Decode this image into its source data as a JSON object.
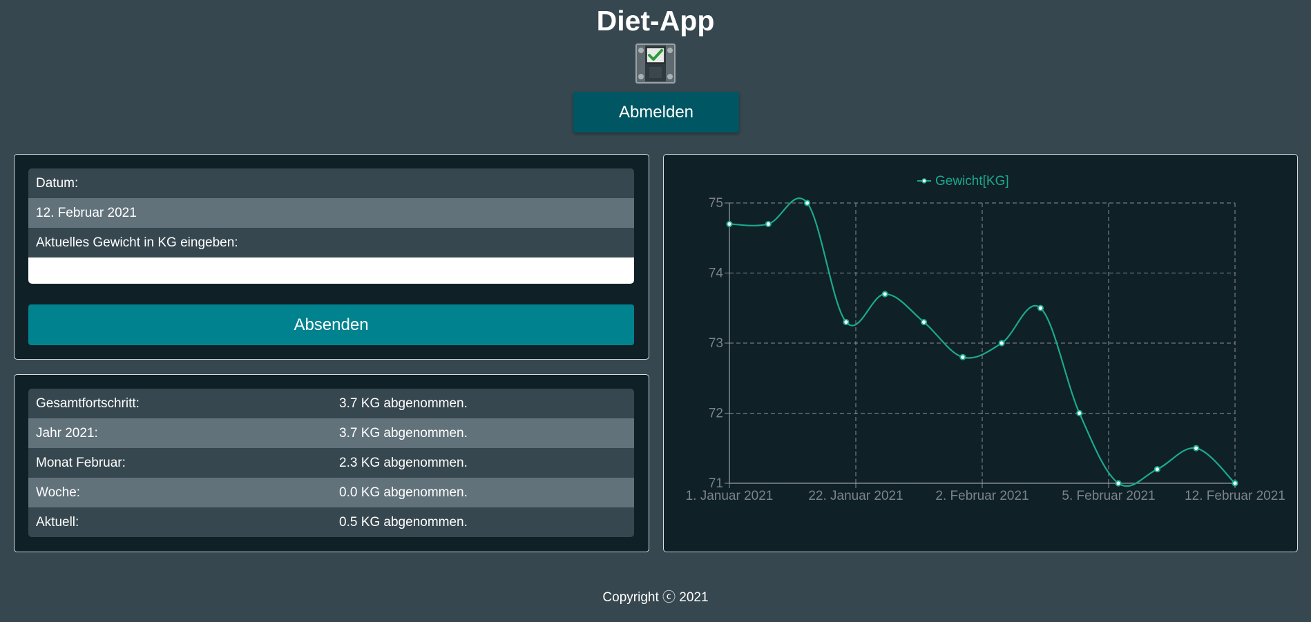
{
  "header": {
    "title": "Diet-App",
    "logout_label": "Abmelden"
  },
  "form": {
    "date_label": "Datum:",
    "date_value": "12. Februar 2021",
    "weight_label": "Aktuelles Gewicht in KG eingeben:",
    "weight_value": "",
    "submit_label": "Absenden"
  },
  "stats": {
    "rows": [
      {
        "label": "Gesamtfortschritt:",
        "value": "3.7 KG abgenommen."
      },
      {
        "label": "Jahr 2021:",
        "value": "3.7 KG abgenommen."
      },
      {
        "label": "Monat Februar:",
        "value": "2.3 KG abgenommen."
      },
      {
        "label": "Woche:",
        "value": "0.0 KG abgenommen."
      },
      {
        "label": "Aktuell:",
        "value": "0.5 KG abgenommen."
      }
    ]
  },
  "footer": {
    "copyright": "Copyright ⓒ 2021"
  },
  "colors": {
    "background": "#37474f",
    "panel": "#102027",
    "accent": "#00838f",
    "logout": "#005662",
    "series": "#1aaa8f"
  },
  "icons": {
    "logo": "scale-check-icon"
  },
  "chart_data": {
    "type": "line",
    "legend": [
      "Gewicht[KG]"
    ],
    "legend_position": "top",
    "categories": [
      "1. Januar 2021",
      "22. Januar 2021",
      "2. Februar 2021",
      "5. Februar 2021",
      "12. Februar 2021"
    ],
    "series": [
      {
        "name": "Gewicht[KG]",
        "values": [
          74.7,
          74.7,
          75.0,
          73.3,
          73.7,
          73.3,
          72.8,
          73.0,
          73.5,
          72.0,
          71.0,
          71.2,
          71.5,
          71.0
        ]
      }
    ],
    "ylim": [
      71,
      75
    ],
    "yticks": [
      71,
      72,
      73,
      74,
      75
    ],
    "grid": true
  }
}
